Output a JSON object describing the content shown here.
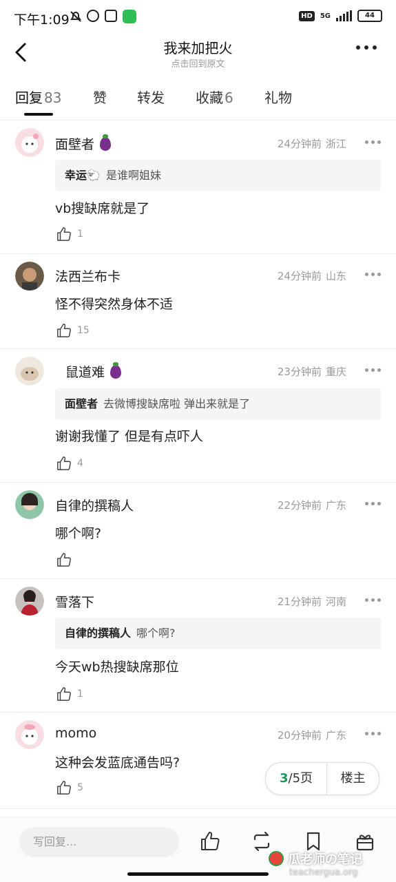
{
  "status_bar": {
    "time": "下午1:09",
    "hd": "HD",
    "network": "5G",
    "battery": "44"
  },
  "nav": {
    "title": "我来加把火",
    "subtitle": "点击回到原文"
  },
  "tabs": [
    {
      "label": "回复",
      "count": "83"
    },
    {
      "label": "赞",
      "count": ""
    },
    {
      "label": "转发",
      "count": ""
    },
    {
      "label": "收藏",
      "count": "6"
    },
    {
      "label": "礼物",
      "count": ""
    }
  ],
  "comments": [
    {
      "name": "面壁者",
      "vip": true,
      "time": "24分钟前",
      "location": "浙江",
      "quote_user": "幸运🐑",
      "quote_text": "是谁啊姐妹",
      "text": "vb搜缺席就是了",
      "likes": "1"
    },
    {
      "name": "法西兰布卡",
      "vip": false,
      "time": "24分钟前",
      "location": "山东",
      "quote_user": "",
      "quote_text": "",
      "text": "怪不得突然身体不适",
      "likes": "15"
    },
    {
      "name": "鼠道难",
      "vip": true,
      "time": "23分钟前",
      "location": "重庆",
      "quote_user": "面壁者",
      "quote_text": "去微博搜缺席啦 弹出来就是了",
      "text": "谢谢我懂了  但是有点吓人",
      "likes": "4"
    },
    {
      "name": "自律的撰稿人",
      "vip": false,
      "time": "22分钟前",
      "location": "广东",
      "quote_user": "",
      "quote_text": "",
      "text": "哪个啊?",
      "likes": ""
    },
    {
      "name": "雪落下",
      "vip": false,
      "time": "21分钟前",
      "location": "河南",
      "quote_user": "自律的撰稿人",
      "quote_text": "哪个啊?",
      "text": "今天wb热搜缺席那位",
      "likes": "1"
    },
    {
      "name": "momo",
      "vip": false,
      "time": "20分钟前",
      "location": "广东",
      "quote_user": "",
      "quote_text": "",
      "text": "这种会发蓝底通告吗?",
      "likes": "5"
    }
  ],
  "pager": {
    "current": "3",
    "total": "/5页",
    "owner_label": "楼主"
  },
  "bottom": {
    "reply_placeholder": "写回复..."
  },
  "watermark": {
    "title": "瓜老师の笔记",
    "site": "teachergua.org"
  },
  "colors": {
    "accent_green": "#1a9a5c",
    "vip_purple": "#7a2e8e"
  }
}
